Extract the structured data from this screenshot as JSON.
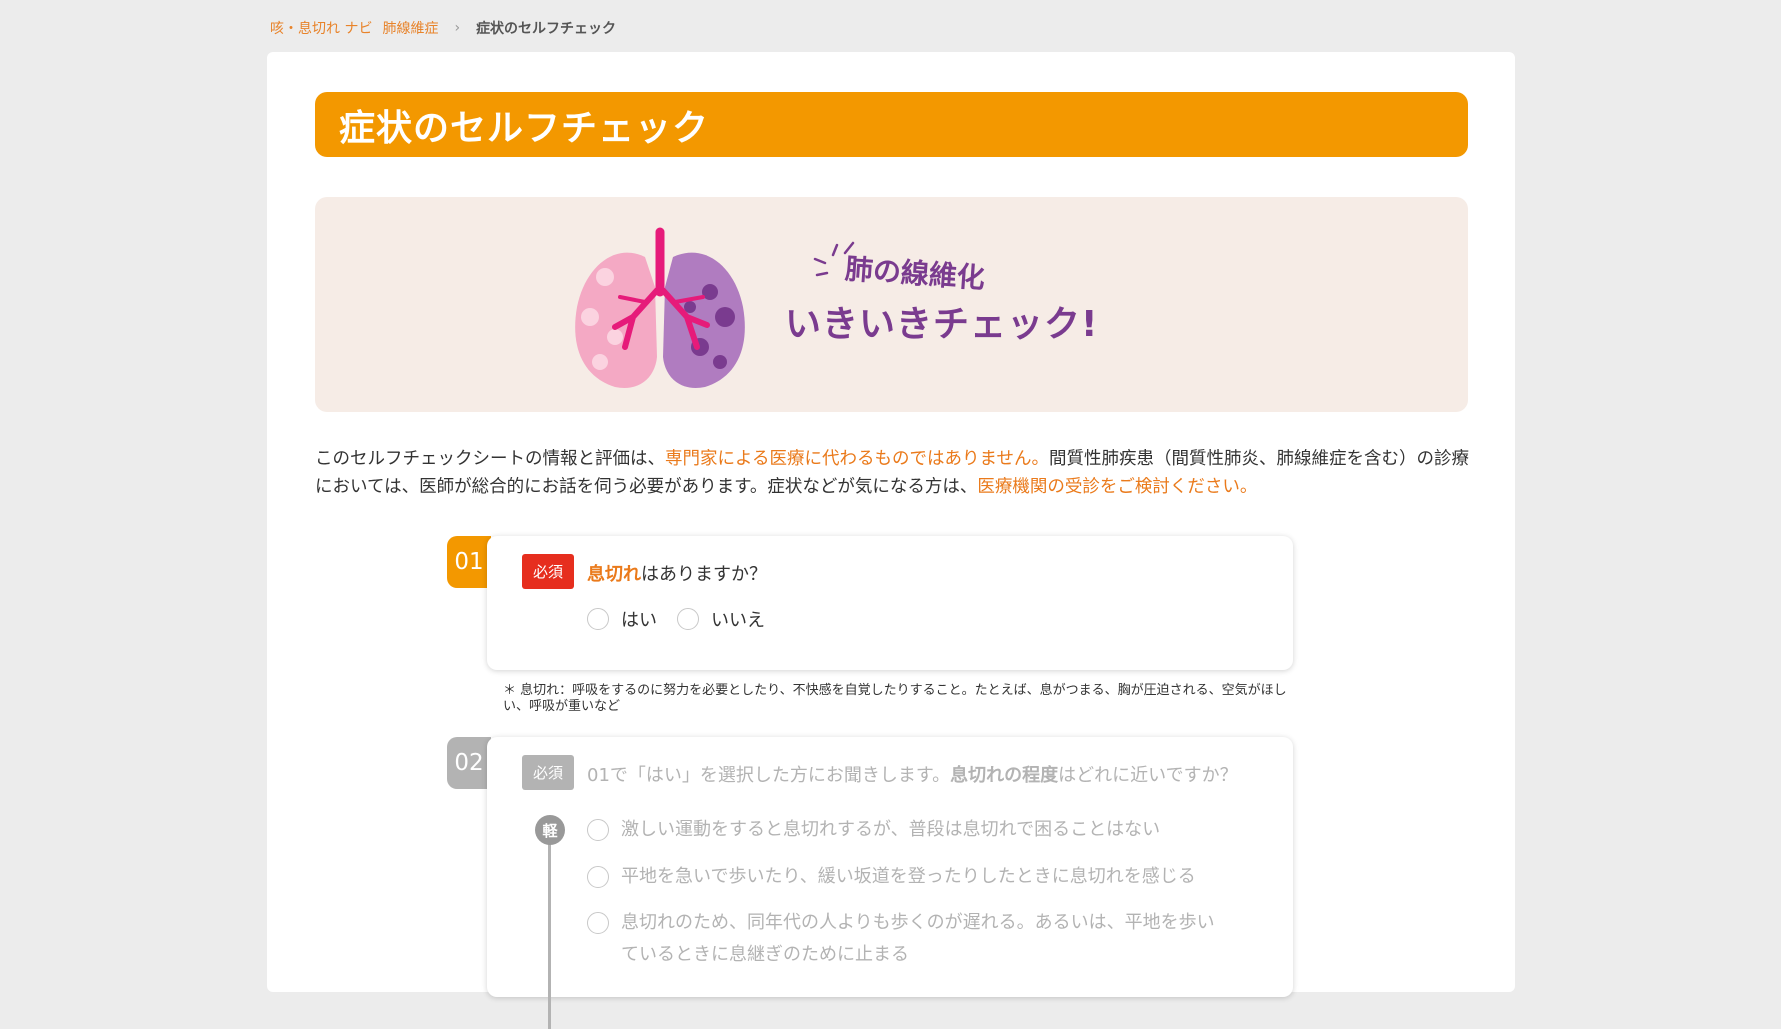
{
  "breadcrumb": {
    "items": [
      "咳・息切れ ナビ",
      "肺線維症"
    ],
    "current": "症状のセルフチェック"
  },
  "page": {
    "title": "症状のセルフチェック"
  },
  "banner": {
    "line1": "肺の線維化",
    "line2": "いきいきチェック!"
  },
  "intro": {
    "part1": "このセルフチェックシートの情報と評価は、",
    "highlight1": "専門家による医療に代わるものではありません。",
    "part2": "間質性肺疾患（間質性肺炎、肺線維症を含む）の診療においては、医師が総合的にお話を伺う必要があります。症状などが気になる方は、",
    "highlight2": "医療機関の受診をご検討ください。"
  },
  "questions": [
    {
      "number": "01",
      "required_label": "必須",
      "keyword": "息切れ",
      "text_rest": "はありますか？",
      "options": [
        "はい",
        "いいえ"
      ],
      "note": "＊ 息切れ：呼吸をするのに努力を必要としたり、不快感を自覚したりすること。たとえば、息がつまる、胸が圧迫される、空気がほしい、呼吸が重いなど"
    },
    {
      "number": "02",
      "required_label": "必須",
      "text_pre": "01で「はい」を選択した方にお聞きします。",
      "keyword": "息切れの程度",
      "text_rest": "はどれに近いですか？",
      "scale_label": "軽",
      "options": [
        "激しい運動をすると息切れするが、普段は息切れで困ることはない",
        "平地を急いで歩いたり、緩い坂道を登ったりしたときに息切れを感じる",
        "息切れのため、同年代の人よりも歩くのが遅れる。あるいは、平地を歩いているときに息継ぎのために止まる"
      ]
    }
  ],
  "colors": {
    "accent": "#f39800",
    "highlight_text": "#ea7a1b",
    "required": "#e62e1e",
    "disabled": "#b3b3b3",
    "banner_bg": "#f6ece6",
    "banner_text": "#7a3b8f"
  }
}
